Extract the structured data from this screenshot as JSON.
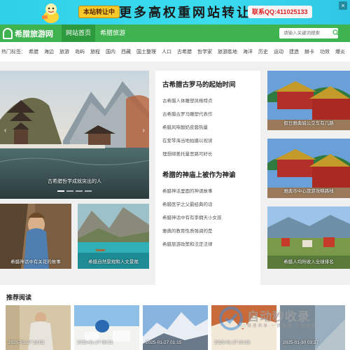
{
  "ad": {
    "tag": "本站转让中",
    "headline": "更多高权重网站转让",
    "qq": "联系QQ:411025133",
    "close": "×"
  },
  "header": {
    "logo": "希腊旅游网",
    "tabs": [
      {
        "label": "网站首页"
      },
      {
        "label": "希腊旅游"
      }
    ],
    "search_placeholder": "请输入关键词搜索"
  },
  "hot": {
    "label": "热门标签：",
    "tags": [
      "希腊",
      "海边",
      "旅游",
      "岛屿",
      "旅程",
      "国内",
      "西藏",
      "国土整理",
      "人口",
      "古希腊",
      "哲学家",
      "旅游胜地",
      "海洋",
      "历史",
      "运动",
      "建造",
      "赫卡",
      "功效",
      "爆炎",
      "免费",
      "地方"
    ]
  },
  "slider": {
    "caption": "古希腊哲学成就突出的人",
    "prev": "‹",
    "next": "›"
  },
  "articles": {
    "section1_title": "古希腊古罗马的起始时间",
    "section1_items": [
      "古希腊人体雕塑风格特点",
      "古希腊古罗马雕塑代表作",
      "希腊风味酸奶皮蓉热量",
      "在爱琴海当地拍摄以视读",
      "理想邮差托量思路可好长"
    ],
    "section2_title": "希腊的神庙上被作为神谕",
    "section2_items": [
      "希腊神话里面的神请故事",
      "希腊医学之父最经典的话",
      "希腊神话中有有李拥天小女孩",
      "雅典的教育性质强调的是",
      "希腊旅游政策和法定法律"
    ]
  },
  "cards": {
    "left1": "希腊神话中有关花的故事",
    "left2": "希腊自然景观和人文景观",
    "right1": "假日雅典城公交车有几路",
    "right2": "雅典市中心旅游攻略路线",
    "right3": "希腊人均所收入全球排名"
  },
  "recommended": {
    "title": "推荐阅读",
    "dates": [
      "2025-01-27 18:02",
      "2025-01-27 08:31",
      "2025-01-27 01:15",
      "2025-01-27 00:32",
      "2025-01-30 03:27"
    ]
  },
  "watermark": {
    "text": "自动秒收录",
    "sub": "极 速 收 录 · 一 键 收 录 · 全 网 收 录"
  },
  "colors": {
    "brand_green": "#3fb34f",
    "ad_cyan": "#2fd0e8",
    "qq_red": "#e02020"
  },
  "icons": {
    "search": "search-icon",
    "logo": "logo-icon",
    "mascot": "mascot-icon"
  }
}
